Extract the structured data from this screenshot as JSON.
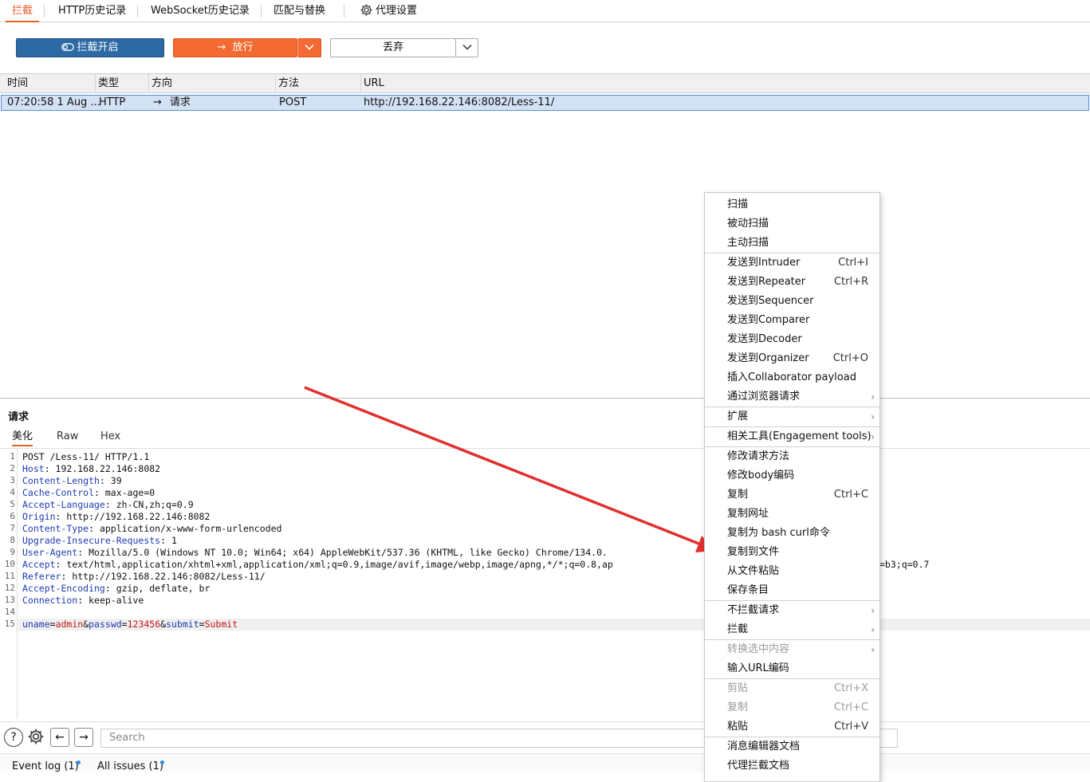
{
  "tabs": [
    "拦截",
    "HTTP历史记录",
    "WebSocket历史记录",
    "匹配与替换",
    "代理设置"
  ],
  "toolbar": {
    "intercept_label": "拦截开启",
    "forward_label": "放行",
    "drop_label": "丢弃"
  },
  "table": {
    "headers": [
      "时间",
      "类型",
      "方向",
      "方法",
      "URL"
    ],
    "row": {
      "time": "07:20:58 1 Aug ...",
      "type": "HTTP",
      "direction": "请求",
      "method": "POST",
      "url": "http://192.168.22.146:8082/Less-11/"
    }
  },
  "request": {
    "title": "请求",
    "subtabs": [
      "美化",
      "Raw",
      "Hex"
    ],
    "lines": [
      {
        "n": "1",
        "k": "",
        "v": "POST /Less-11/ HTTP/1.1"
      },
      {
        "n": "2",
        "k": "Host",
        "v": ": 192.168.22.146:8082"
      },
      {
        "n": "3",
        "k": "Content-Length",
        "v": ": 39"
      },
      {
        "n": "4",
        "k": "Cache-Control",
        "v": ": max-age=0"
      },
      {
        "n": "5",
        "k": "Accept-Language",
        "v": ": zh-CN,zh;q=0.9"
      },
      {
        "n": "6",
        "k": "Origin",
        "v": ": http://192.168.22.146:8082"
      },
      {
        "n": "7",
        "k": "Content-Type",
        "v": ": application/x-www-form-urlencoded"
      },
      {
        "n": "8",
        "k": "Upgrade-Insecure-Requests",
        "v": ": 1"
      },
      {
        "n": "9",
        "k": "User-Agent",
        "v": ": Mozilla/5.0 (Windows NT 10.0; Win64; x64) AppleWebKit/537.36 (KHTML, like Gecko) Chrome/134.0."
      },
      {
        "n": "10",
        "k": "Accept",
        "v": ": text/html,application/xhtml+xml,application/xml;q=0.9,image/avif,image/webp,image/apng,*/*;q=0.8,ap"
      },
      {
        "n": "11",
        "k": "Referer",
        "v": ": http://192.168.22.146:8082/Less-11/"
      },
      {
        "n": "12",
        "k": "Accept-Encoding",
        "v": ": gzip, deflate, br"
      },
      {
        "n": "13",
        "k": "Connection",
        "v": ": keep-alive"
      },
      {
        "n": "14",
        "k": "",
        "v": ""
      }
    ],
    "line10_tail": "=b3;q=0.7",
    "body": {
      "n": "15",
      "k1": "uname",
      "v1": "admin",
      "k2": "passwd",
      "v2": "123456",
      "k3": "submit",
      "v3": "Submit"
    }
  },
  "bottom": {
    "search_placeholder": "Search",
    "event_log": "Event log (1)",
    "all_issues": "All issues (1)"
  },
  "menu": [
    {
      "label": "扫描"
    },
    {
      "label": "被动扫描"
    },
    {
      "label": "主动扫描"
    },
    {
      "sep": true
    },
    {
      "label": "发送到Intruder",
      "shortcut": "Ctrl+I"
    },
    {
      "label": "发送到Repeater",
      "shortcut": "Ctrl+R"
    },
    {
      "label": "发送到Sequencer"
    },
    {
      "label": "发送到Comparer"
    },
    {
      "label": "发送到Decoder"
    },
    {
      "label": "发送到Organizer",
      "shortcut": "Ctrl+O"
    },
    {
      "label": "插入Collaborator payload"
    },
    {
      "label": "通过浏览器请求",
      "submenu": true
    },
    {
      "sep": true
    },
    {
      "label": "扩展",
      "submenu": true
    },
    {
      "sep": true
    },
    {
      "label": "相关工具(Engagement tools)",
      "submenu": true
    },
    {
      "sep": true
    },
    {
      "label": "修改请求方法"
    },
    {
      "label": "修改body编码"
    },
    {
      "label": "复制",
      "shortcut": "Ctrl+C"
    },
    {
      "label": "复制网址"
    },
    {
      "label": "复制为 bash curl命令"
    },
    {
      "label": "复制到文件"
    },
    {
      "label": "从文件粘贴"
    },
    {
      "label": "保存条目"
    },
    {
      "sep": true
    },
    {
      "label": "不拦截请求",
      "submenu": true
    },
    {
      "label": "拦截",
      "submenu": true
    },
    {
      "sep": true
    },
    {
      "label": "转换选中内容",
      "submenu": true,
      "disabled": true
    },
    {
      "label": "输入URL编码"
    },
    {
      "sep": true
    },
    {
      "label": "剪贴",
      "shortcut": "Ctrl+X",
      "disabled": true
    },
    {
      "label": "复制",
      "shortcut": "Ctrl+C",
      "disabled": true
    },
    {
      "label": "粘贴",
      "shortcut": "Ctrl+V"
    },
    {
      "sep": true
    },
    {
      "label": "消息编辑器文档"
    },
    {
      "label": "代理拦截文档"
    }
  ],
  "colors": {
    "accent": "#e8612c",
    "intercept_button": "#2d6aa5",
    "forward_button": "#f36b32",
    "row_selected": "#d3e1f5",
    "arrow": "#e03030"
  }
}
